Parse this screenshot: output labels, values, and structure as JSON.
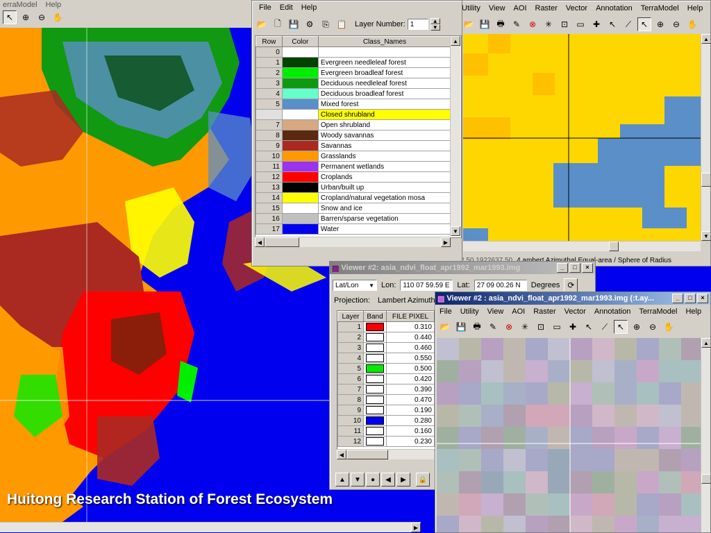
{
  "background_map": {
    "menu": [
      "erraModel",
      "Help"
    ],
    "caption": "Huitong Research Station of Forest Ecosystem"
  },
  "legend_window": {
    "menu": [
      "File",
      "Edit",
      "Help"
    ],
    "layer_number_label": "Layer Number:",
    "layer_number_value": "1",
    "headers": {
      "row": "Row",
      "color": "Color",
      "class": "Class_Names"
    },
    "rows": [
      {
        "n": "0",
        "color": "#ffffff",
        "name": ""
      },
      {
        "n": "1",
        "color": "#004400",
        "name": "Evergreen needleleaf forest"
      },
      {
        "n": "2",
        "color": "#00ee00",
        "name": "Evergreen broadleaf forest"
      },
      {
        "n": "3",
        "color": "#119911",
        "name": "Deciduous needleleaf forest"
      },
      {
        "n": "4",
        "color": "#66ffcc",
        "name": "Deciduous broadleaf forest"
      },
      {
        "n": "5",
        "color": "#5a8fc8",
        "name": "Mixed forest"
      },
      {
        "n": "",
        "color": "#f4c040",
        "name": "Closed shrubland"
      },
      {
        "n": "7",
        "color": "#d8a880",
        "name": "Open shrubland"
      },
      {
        "n": "8",
        "color": "#5a2a10",
        "name": "Woody savannas"
      },
      {
        "n": "9",
        "color": "#aa2a22",
        "name": "Savannas"
      },
      {
        "n": "10",
        "color": "#ff9900",
        "name": "Grasslands"
      },
      {
        "n": "11",
        "color": "#9933ee",
        "name": "Permanent wetlands"
      },
      {
        "n": "12",
        "color": "#ff0000",
        "name": "Croplands"
      },
      {
        "n": "13",
        "color": "#000000",
        "name": "Urban/built up"
      },
      {
        "n": "14",
        "color": "#ffff00",
        "name": "Cropland/natural vegetation mosa"
      },
      {
        "n": "15",
        "color": "#ffffff",
        "name": "Snow and ice"
      },
      {
        "n": "16",
        "color": "#c0c0c0",
        "name": "Barren/sparse vegetation"
      },
      {
        "n": "17",
        "color": "#0000ee",
        "name": "Water"
      }
    ],
    "selected_row_index": 6
  },
  "viewer_top_right": {
    "menu": [
      "Utility",
      "View",
      "AOI",
      "Raster",
      "Vector",
      "Annotation",
      "TerraModel",
      "Help"
    ],
    "status_left": "2.50    1922637.50",
    "status_right": "4 ambert Azimuthal Equal-area / Sphere of Radius"
  },
  "inquire_window": {
    "title": "Viewer #2:  asia_ndvi_float_apr1992_mar1993.img",
    "coord_type": "Lat/Lon",
    "lon_label": "Lon:",
    "lon_value": "110 07 59.59 E",
    "lat_label": "Lat:",
    "lat_value": "27 09 00.26 N",
    "units": "Degrees",
    "projection_label": "Projection:",
    "projection_value": "Lambert Azimuth",
    "headers": {
      "layer": "Layer",
      "band": "Band",
      "pixel": "FILE PIXEL"
    },
    "rows": [
      {
        "layer": "1",
        "band": "#ff0000",
        "value": "0.310"
      },
      {
        "layer": "2",
        "band": "#ffffff",
        "value": "0.440"
      },
      {
        "layer": "3",
        "band": "#ffffff",
        "value": "0.460"
      },
      {
        "layer": "4",
        "band": "#ffffff",
        "value": "0.550"
      },
      {
        "layer": "5",
        "band": "#00ee00",
        "value": "0.500"
      },
      {
        "layer": "6",
        "band": "#ffffff",
        "value": "0.420"
      },
      {
        "layer": "7",
        "band": "#ffffff",
        "value": "0.390"
      },
      {
        "layer": "8",
        "band": "#ffffff",
        "value": "0.470"
      },
      {
        "layer": "9",
        "band": "#ffffff",
        "value": "0.190"
      },
      {
        "layer": "10",
        "band": "#0000ee",
        "value": "0.280"
      },
      {
        "layer": "11",
        "band": "#ffffff",
        "value": "0.160"
      },
      {
        "layer": "12",
        "band": "#ffffff",
        "value": "0.230"
      }
    ]
  },
  "viewer2_window": {
    "title": "Viewer #2 : asia_ndvi_float_apr1992_mar1993.img (:t.ay...",
    "menu": [
      "File",
      "Utility",
      "View",
      "AOI",
      "Raster",
      "Vector",
      "Annotation",
      "TerraModel",
      "Help"
    ]
  }
}
